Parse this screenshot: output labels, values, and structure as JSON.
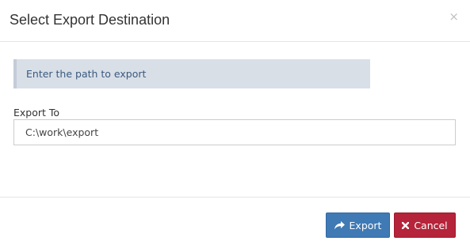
{
  "dialog": {
    "title": "Select Export Destination",
    "close_glyph": "×"
  },
  "alert": {
    "text": "Enter the path to export",
    "color": "#d9dfe7"
  },
  "export_field": {
    "label": "Export To",
    "value": "C:\\work\\export"
  },
  "footer": {
    "export_label": "Export",
    "export_icon": "share-arrow-icon",
    "export_color": "#3f7ab5",
    "cancel_label": "Cancel",
    "cancel_icon": "x-icon",
    "cancel_color": "#b5243a"
  }
}
